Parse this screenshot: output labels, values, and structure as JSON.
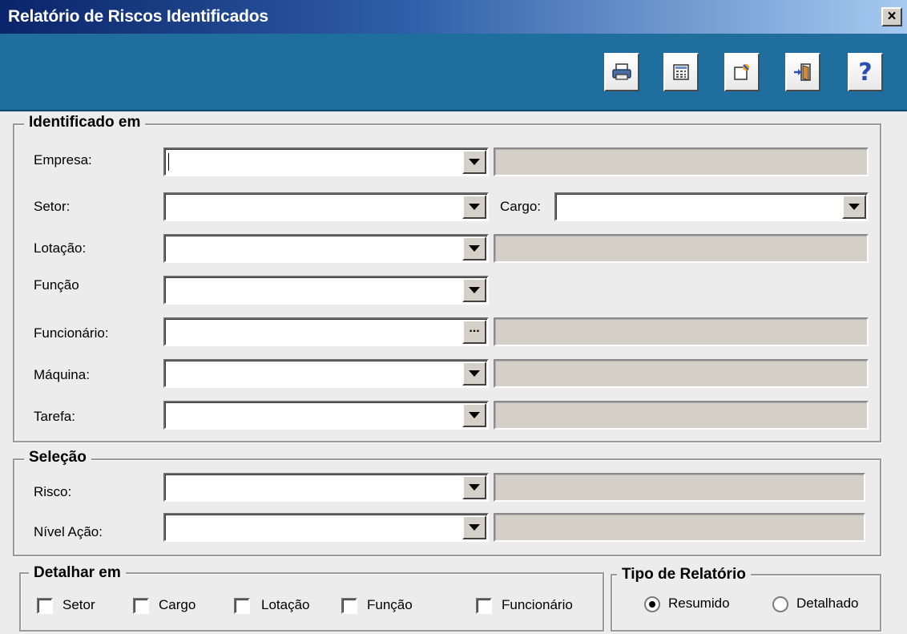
{
  "window": {
    "title": "Relatório de Riscos Identificados",
    "close_glyph": "×"
  },
  "toolbar": {
    "buttons": [
      {
        "icon": "printer-icon"
      },
      {
        "icon": "calculator-icon"
      },
      {
        "icon": "edit-document-icon"
      },
      {
        "icon": "exit-door-icon"
      },
      {
        "icon": "help-icon",
        "glyph": "?"
      }
    ]
  },
  "identificado": {
    "legend": "Identificado em",
    "empresa_label": "Empresa:",
    "setor_label": "Setor:",
    "cargo_label": "Cargo:",
    "lotacao_label": "Lotação:",
    "funcao_label": "Função",
    "funcionario_label": "Funcionário:",
    "funcionario_button": "...",
    "maquina_label": "Máquina:",
    "tarefa_label": "Tarefa:"
  },
  "selecao": {
    "legend": "Seleção",
    "risco_label": "Risco:",
    "nivel_label": "Nível Ação:"
  },
  "detalhar": {
    "legend": "Detalhar em",
    "options": [
      "Setor",
      "Cargo",
      "Lotação",
      "Função",
      "Funcionário"
    ]
  },
  "tipo": {
    "legend": "Tipo de Relatório",
    "options": [
      "Resumido",
      "Detalhado"
    ],
    "selected": "Resumido"
  }
}
